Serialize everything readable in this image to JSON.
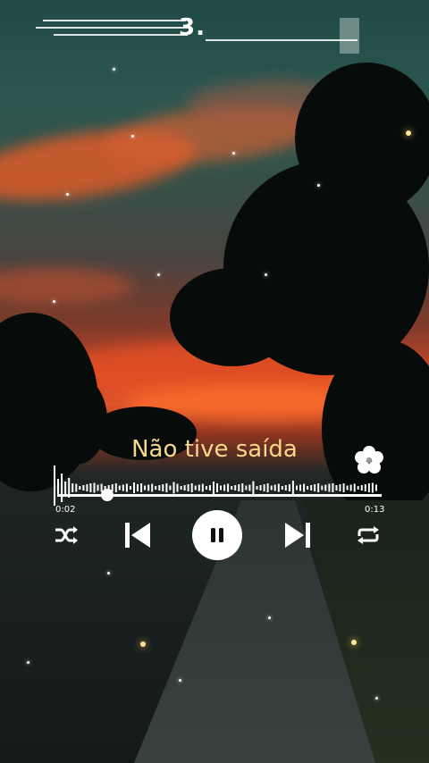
{
  "header": {
    "title": "3."
  },
  "player": {
    "song_title": "Não tive saída",
    "elapsed": "0:02",
    "duration": "0:13",
    "progress": 0.15,
    "state": "playing"
  },
  "icons": {
    "decoration": "hibiscus-flower-icon",
    "shuffle": "shuffle-icon",
    "previous": "skip-previous-icon",
    "pause": "pause-icon",
    "next": "skip-next-icon",
    "repeat": "repeat-icon"
  },
  "colors": {
    "title": "#f6d98a",
    "controls": "#ffffff"
  }
}
